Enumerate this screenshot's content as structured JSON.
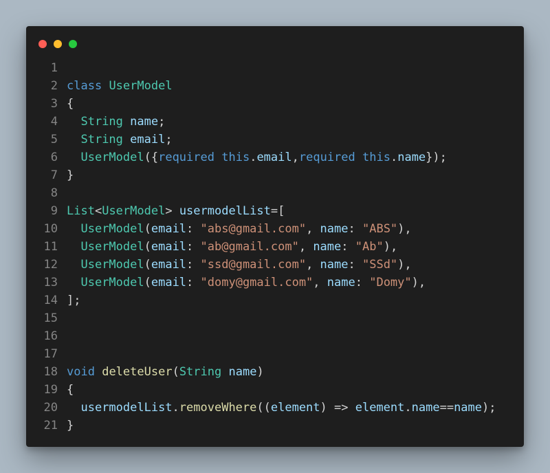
{
  "window": {
    "dots": [
      {
        "name": "close",
        "color": "#ff5f56"
      },
      {
        "name": "minimize",
        "color": "#ffbd2e"
      },
      {
        "name": "zoom",
        "color": "#27c93f"
      }
    ]
  },
  "colors": {
    "background": "#abb8c3",
    "editor_bg": "#1e1e1e",
    "keyword": "#569cd6",
    "type": "#4ec9b0",
    "variable": "#9cdcfe",
    "function": "#dcdcaa",
    "string": "#ce9178",
    "punctuation": "#d4d4d4",
    "line_number": "#858585"
  },
  "code_lines": [
    {
      "n": "1",
      "tokens": []
    },
    {
      "n": "2",
      "tokens": [
        [
          "kw",
          "class"
        ],
        [
          "plain",
          " "
        ],
        [
          "type",
          "UserModel"
        ]
      ]
    },
    {
      "n": "3",
      "tokens": [
        [
          "punc",
          "{"
        ]
      ]
    },
    {
      "n": "4",
      "tokens": [
        [
          "plain",
          "  "
        ],
        [
          "type",
          "String"
        ],
        [
          "plain",
          " "
        ],
        [
          "var",
          "name"
        ],
        [
          "punc",
          ";"
        ]
      ]
    },
    {
      "n": "5",
      "tokens": [
        [
          "plain",
          "  "
        ],
        [
          "type",
          "String"
        ],
        [
          "plain",
          " "
        ],
        [
          "var",
          "email"
        ],
        [
          "punc",
          ";"
        ]
      ]
    },
    {
      "n": "6",
      "tokens": [
        [
          "plain",
          "  "
        ],
        [
          "type",
          "UserModel"
        ],
        [
          "punc",
          "({"
        ],
        [
          "kw",
          "required"
        ],
        [
          "plain",
          " "
        ],
        [
          "kw",
          "this"
        ],
        [
          "punc",
          "."
        ],
        [
          "var",
          "email"
        ],
        [
          "punc",
          ","
        ],
        [
          "kw",
          "required"
        ],
        [
          "plain",
          " "
        ],
        [
          "kw",
          "this"
        ],
        [
          "punc",
          "."
        ],
        [
          "var",
          "name"
        ],
        [
          "punc",
          "});"
        ]
      ]
    },
    {
      "n": "7",
      "tokens": [
        [
          "punc",
          "}"
        ]
      ]
    },
    {
      "n": "8",
      "tokens": []
    },
    {
      "n": "9",
      "tokens": [
        [
          "type",
          "List"
        ],
        [
          "punc",
          "<"
        ],
        [
          "type",
          "UserModel"
        ],
        [
          "punc",
          "> "
        ],
        [
          "var",
          "usermodelList"
        ],
        [
          "punc",
          "=["
        ]
      ]
    },
    {
      "n": "10",
      "tokens": [
        [
          "plain",
          "  "
        ],
        [
          "type",
          "UserModel"
        ],
        [
          "punc",
          "("
        ],
        [
          "var",
          "email"
        ],
        [
          "punc",
          ": "
        ],
        [
          "str",
          "\"abs@gmail.com\""
        ],
        [
          "punc",
          ", "
        ],
        [
          "var",
          "name"
        ],
        [
          "punc",
          ": "
        ],
        [
          "str",
          "\"ABS\""
        ],
        [
          "punc",
          "),"
        ]
      ]
    },
    {
      "n": "11",
      "tokens": [
        [
          "plain",
          "  "
        ],
        [
          "type",
          "UserModel"
        ],
        [
          "punc",
          "("
        ],
        [
          "var",
          "email"
        ],
        [
          "punc",
          ": "
        ],
        [
          "str",
          "\"ab@gmail.com\""
        ],
        [
          "punc",
          ", "
        ],
        [
          "var",
          "name"
        ],
        [
          "punc",
          ": "
        ],
        [
          "str",
          "\"Ab\""
        ],
        [
          "punc",
          "),"
        ]
      ]
    },
    {
      "n": "12",
      "tokens": [
        [
          "plain",
          "  "
        ],
        [
          "type",
          "UserModel"
        ],
        [
          "punc",
          "("
        ],
        [
          "var",
          "email"
        ],
        [
          "punc",
          ": "
        ],
        [
          "str",
          "\"ssd@gmail.com\""
        ],
        [
          "punc",
          ", "
        ],
        [
          "var",
          "name"
        ],
        [
          "punc",
          ": "
        ],
        [
          "str",
          "\"SSd\""
        ],
        [
          "punc",
          "),"
        ]
      ]
    },
    {
      "n": "13",
      "tokens": [
        [
          "plain",
          "  "
        ],
        [
          "type",
          "UserModel"
        ],
        [
          "punc",
          "("
        ],
        [
          "var",
          "email"
        ],
        [
          "punc",
          ": "
        ],
        [
          "str",
          "\"domy@gmail.com\""
        ],
        [
          "punc",
          ", "
        ],
        [
          "var",
          "name"
        ],
        [
          "punc",
          ": "
        ],
        [
          "str",
          "\"Domy\""
        ],
        [
          "punc",
          "),"
        ]
      ]
    },
    {
      "n": "14",
      "tokens": [
        [
          "punc",
          "];"
        ]
      ]
    },
    {
      "n": "15",
      "tokens": []
    },
    {
      "n": "16",
      "tokens": []
    },
    {
      "n": "17",
      "tokens": []
    },
    {
      "n": "18",
      "tokens": [
        [
          "kw",
          "void"
        ],
        [
          "plain",
          " "
        ],
        [
          "fn",
          "deleteUser"
        ],
        [
          "punc",
          "("
        ],
        [
          "type",
          "String"
        ],
        [
          "plain",
          " "
        ],
        [
          "var",
          "name"
        ],
        [
          "punc",
          ")"
        ]
      ]
    },
    {
      "n": "19",
      "tokens": [
        [
          "punc",
          "{"
        ]
      ]
    },
    {
      "n": "20",
      "tokens": [
        [
          "plain",
          "  "
        ],
        [
          "var",
          "usermodelList"
        ],
        [
          "punc",
          "."
        ],
        [
          "fn",
          "removeWhere"
        ],
        [
          "punc",
          "(("
        ],
        [
          "var",
          "element"
        ],
        [
          "punc",
          ") => "
        ],
        [
          "var",
          "element"
        ],
        [
          "punc",
          "."
        ],
        [
          "var",
          "name"
        ],
        [
          "punc",
          "=="
        ],
        [
          "var",
          "name"
        ],
        [
          "punc",
          ");"
        ]
      ]
    },
    {
      "n": "21",
      "tokens": [
        [
          "punc",
          "}"
        ]
      ]
    }
  ]
}
